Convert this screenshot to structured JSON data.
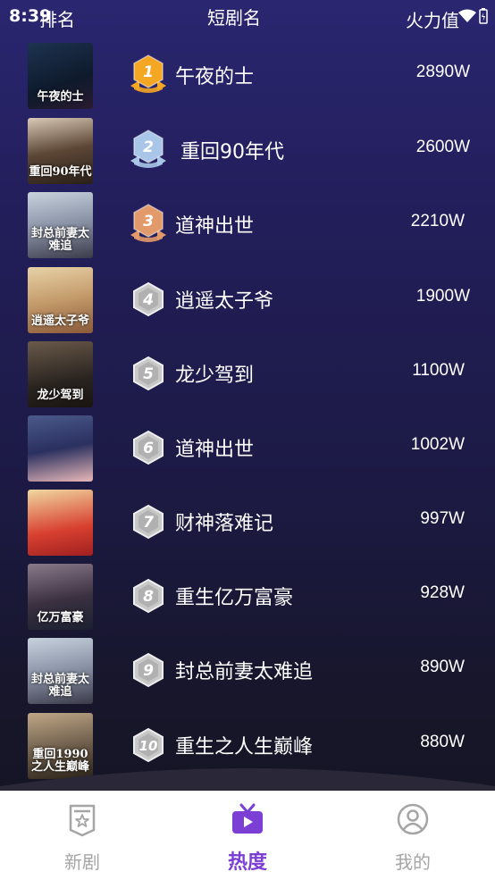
{
  "status": {
    "time": "8:39"
  },
  "header": {
    "left_label": "排名",
    "title": "短剧名",
    "right_label": "火力值"
  },
  "colors": {
    "accent": "#7b3fd6",
    "gold": "#f5a623",
    "silver": "#a9c6e8",
    "bronze": "#e39a6a",
    "gray_badge": "#c8c8c8"
  },
  "rank_list": [
    {
      "rank": "1",
      "title": "午夜的士",
      "count": "2890W",
      "poster_text": "午夜的士"
    },
    {
      "rank": "2",
      "title": "重回90年代",
      "count": "2600W",
      "poster_text": "重回90年代"
    },
    {
      "rank": "3",
      "title": "道神出世",
      "count": "2210W",
      "poster_text": "封总前妻太难追"
    },
    {
      "rank": "4",
      "title": "逍遥太子爷",
      "count": "1900W",
      "poster_text": "逍遥太子爷"
    },
    {
      "rank": "5",
      "title": "龙少驾到",
      "count": "1100W",
      "poster_text": "龙少驾到"
    },
    {
      "rank": "6",
      "title": "道神出世",
      "count": "1002W",
      "poster_text": ""
    },
    {
      "rank": "7",
      "title": "财神落难记",
      "count": "997W",
      "poster_text": ""
    },
    {
      "rank": "8",
      "title": "重生亿万富豪",
      "count": "928W",
      "poster_text": "亿万富豪"
    },
    {
      "rank": "9",
      "title": "封总前妻太难追",
      "count": "890W",
      "poster_text": "封总前妻太难追"
    },
    {
      "rank": "10",
      "title": "重生之人生巅峰",
      "count": "880W",
      "poster_text": "重回1990之人生巅峰"
    }
  ],
  "tabs": [
    {
      "label": "新剧",
      "icon": "star-badge-icon",
      "active": false
    },
    {
      "label": "热度",
      "icon": "tv-icon",
      "active": true
    },
    {
      "label": "我的",
      "icon": "user-icon",
      "active": false
    }
  ]
}
